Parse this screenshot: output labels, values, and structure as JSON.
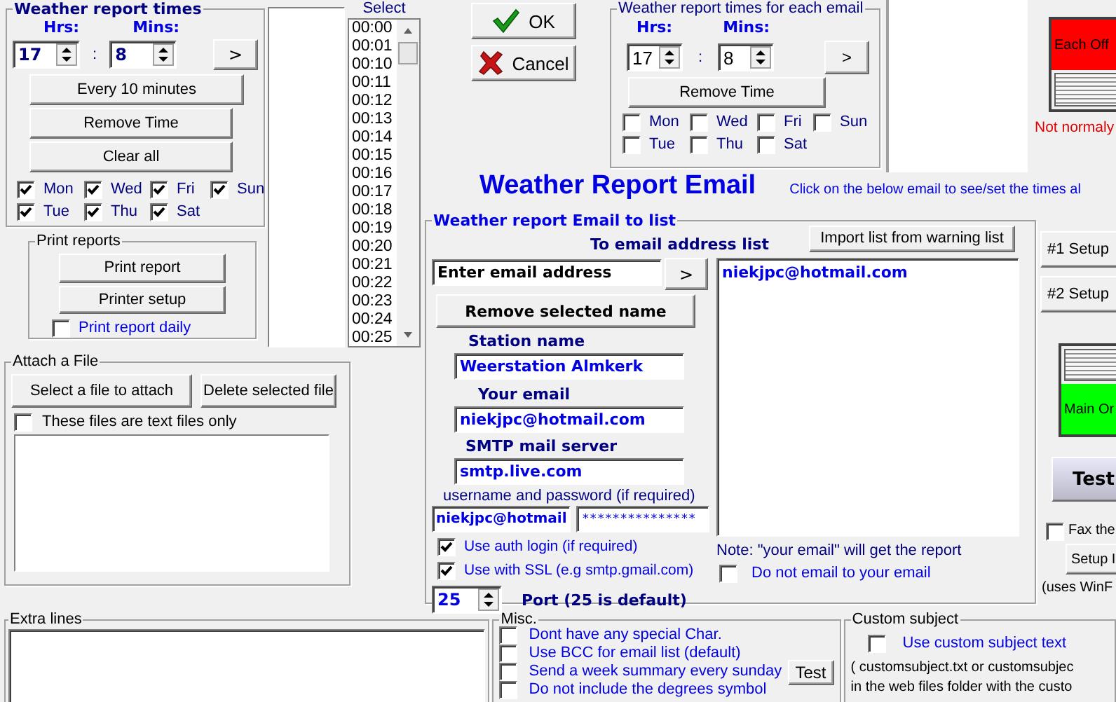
{
  "times_group": {
    "title": "Weather report times",
    "hrs_label": "Hrs:",
    "mins_label": "Mins:",
    "hrs": "17",
    "separator": ":",
    "mins": "8",
    "add_button": ">",
    "buttons": [
      "Every 10 minutes",
      "Remove Time",
      "Clear all"
    ],
    "days": [
      {
        "label": "Mon",
        "checked": true
      },
      {
        "label": "Wed",
        "checked": true
      },
      {
        "label": "Fri",
        "checked": true
      },
      {
        "label": "Sun",
        "checked": true
      },
      {
        "label": "Tue",
        "checked": true
      },
      {
        "label": "Thu",
        "checked": true
      },
      {
        "label": "Sat",
        "checked": true
      }
    ]
  },
  "print_group": {
    "title": "Print reports",
    "buttons": [
      "Print report",
      "Printer setup"
    ],
    "daily": {
      "label": "Print report daily",
      "checked": false
    }
  },
  "time_list": {
    "header": "Select",
    "items": [
      "00:00",
      "00:01",
      "00:10",
      "00:11",
      "00:12",
      "00:13",
      "00:14",
      "00:15",
      "00:16",
      "00:17",
      "00:18",
      "00:19",
      "00:20",
      "00:21",
      "00:22",
      "00:23",
      "00:24",
      "00:25"
    ]
  },
  "attach_group": {
    "title": "Attach a File",
    "buttons": [
      "Select a file to attach",
      "Delete selected file"
    ],
    "text_only": {
      "label": "These files are text files only",
      "checked": false
    }
  },
  "ok_button": "OK",
  "cancel_button": "Cancel",
  "each_group": {
    "title": "Weather report times for each email",
    "hrs_label": "Hrs:",
    "mins_label": "Mins:",
    "hrs": "17",
    "separator": ":",
    "mins": "8",
    "add_button": ">",
    "remove_button": "Remove Time",
    "days": [
      {
        "label": "Mon",
        "checked": false
      },
      {
        "label": "Wed",
        "checked": false
      },
      {
        "label": "Fri",
        "checked": false
      },
      {
        "label": "Sun",
        "checked": false
      },
      {
        "label": "Tue",
        "checked": false
      },
      {
        "label": "Thu",
        "checked": false
      },
      {
        "label": "Sat",
        "checked": false
      }
    ]
  },
  "heading": "Weather Report Email",
  "hint": "Click on the below email to see/set the times al",
  "each_indicator": {
    "label": "Each Off",
    "on": false,
    "note": "Not normaly"
  },
  "email_group": {
    "title": "Weather report Email to list",
    "list_label": "To email address list",
    "import_button": "Import list from warning list",
    "email_input": "Enter email address",
    "add_button": ">",
    "remove_button": "Remove selected name",
    "station_label": "Station name",
    "station": "Weerstation Almkerk",
    "your_email_label": "Your email",
    "your_email": "niekjpc@hotmail.com",
    "smtp_label": "SMTP mail server",
    "smtp": "smtp.live.com",
    "credentials_label": "username and password (if required)",
    "username": "niekjpc@hotmail",
    "password": "***************",
    "auth": {
      "label": "Use auth login (if required)",
      "checked": true
    },
    "ssl": {
      "label": "Use with SSL (e.g smtp.gmail.com)",
      "checked": true
    },
    "port": "25",
    "port_label": "Port (25 is default)",
    "emails": [
      {
        "address": "niekjpc@hotmail.com",
        "selected": false
      }
    ],
    "note": "Note: \"your email\" will get the report",
    "no_self": {
      "label": "Do not email to your email",
      "checked": false
    }
  },
  "right_panel": {
    "setup_buttons": [
      "#1 Setup",
      "#2 Setup"
    ],
    "main_indicator": {
      "label": "Main Or",
      "on": true
    },
    "test_button": "Test",
    "fax": {
      "label": "Fax the",
      "checked": false
    },
    "setup_button": "Setup I",
    "uses_note": "(uses WinF"
  },
  "extra_lines": {
    "title": "Extra lines"
  },
  "misc": {
    "title": "Misc.",
    "options": [
      {
        "label": "Dont have any special Char.",
        "checked": false
      },
      {
        "label": "Use BCC for email list (default)",
        "checked": false
      },
      {
        "label": "Send a week summary every sunday",
        "checked": false
      },
      {
        "label": "Do not include the degrees symbol",
        "checked": false
      }
    ],
    "test_button": "Test"
  },
  "custom_subject": {
    "title": "Custom subject",
    "option": {
      "label": "Use custom subject text",
      "checked": false
    },
    "lines": [
      "( customsubject.txt or customsubjec",
      "in the web files folder with the custo"
    ]
  }
}
